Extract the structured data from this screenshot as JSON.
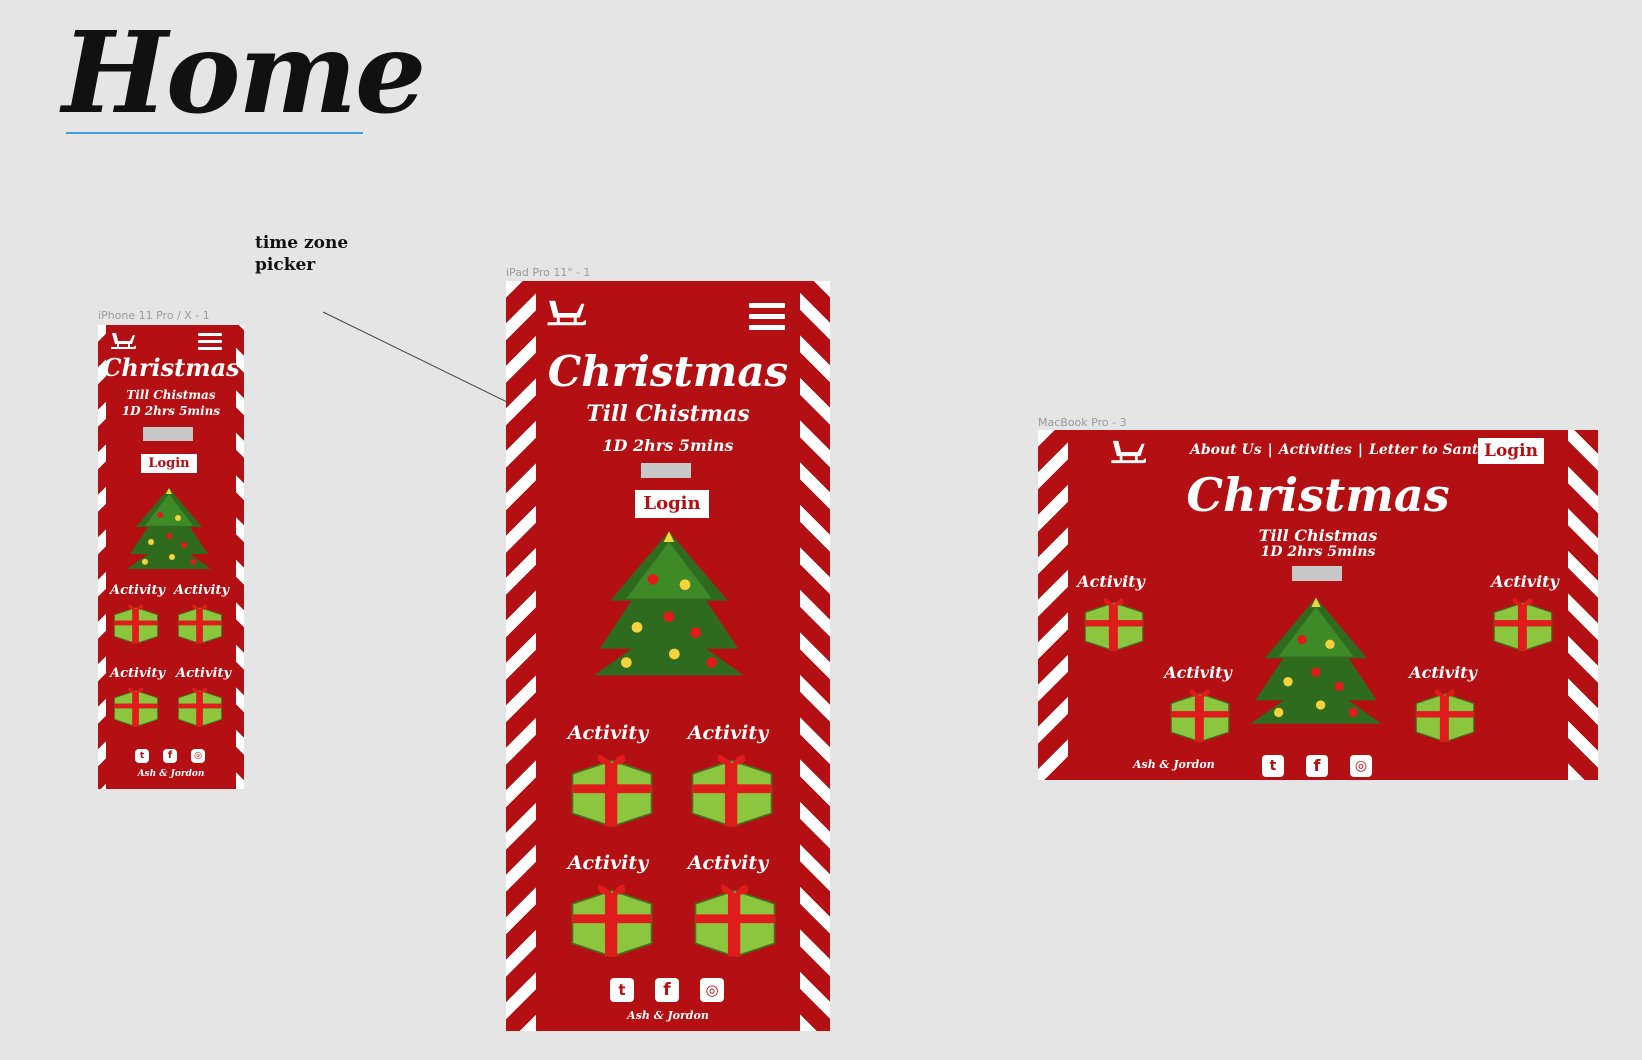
{
  "page": {
    "title": "Home",
    "annotation": "time zone picker"
  },
  "frames": {
    "phone": {
      "label": "iPhone 11 Pro / X - 1"
    },
    "tablet": {
      "label": "iPad Pro 11\" - 1"
    },
    "desktop": {
      "label": "MacBook Pro - 3"
    }
  },
  "content": {
    "heading": "Christmas",
    "subheading": "Till Chistmas",
    "countdown": "1D 2hrs 5mins",
    "login_label": "Login",
    "activity_label": "Activity",
    "credit": "Ash & Jordon"
  },
  "desktop_nav": {
    "about": "About Us",
    "activities": "Activities",
    "letter": "Letter to Santa",
    "separator": "|"
  },
  "social": {
    "twitter": "twitter-icon",
    "facebook": "facebook-icon",
    "instagram": "instagram-icon"
  },
  "colors": {
    "brand_red": "#b40f12",
    "stripe_white": "#ffffff",
    "gift_green": "#8cc63f",
    "ribbon_red": "#e01b1b",
    "tree_green": "#2f6b1f",
    "picker_gray": "#c8c8c8"
  }
}
